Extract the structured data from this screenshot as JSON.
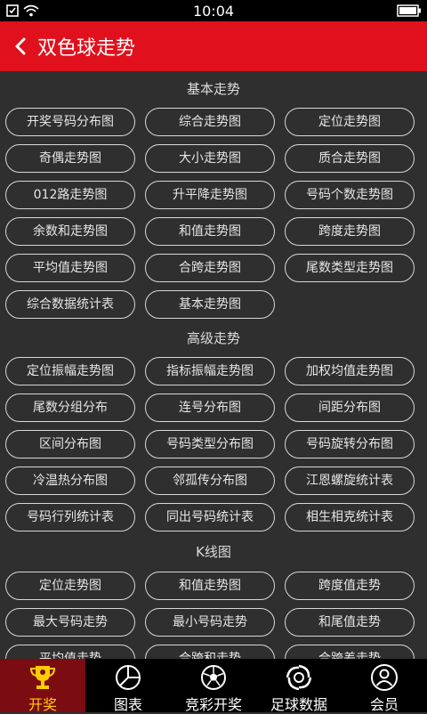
{
  "status": {
    "time": "10:04"
  },
  "header": {
    "title": "双色球走势"
  },
  "sections": [
    {
      "title": "基本走势",
      "items": [
        "开奖号码分布图",
        "综合走势图",
        "定位走势图",
        "奇偶走势图",
        "大小走势图",
        "质合走势图",
        "012路走势图",
        "升平降走势图",
        "号码个数走势图",
        "余数和走势图",
        "和值走势图",
        "跨度走势图",
        "平均值走势图",
        "合跨走势图",
        "尾数类型走势图",
        "综合数据统计表",
        "基本走势图"
      ]
    },
    {
      "title": "高级走势",
      "items": [
        "定位振幅走势图",
        "指标振幅走势图",
        "加权均值走势图",
        "尾数分组分布",
        "连号分布图",
        "间距分布图",
        "区间分布图",
        "号码类型分布图",
        "号码旋转分布图",
        "冷温热分布图",
        "邻孤传分布图",
        "江恩螺旋统计表",
        "号码行列统计表",
        "同出号码统计表",
        "相生相克统计表"
      ]
    },
    {
      "title": "K线图",
      "items": [
        "定位走势图",
        "和值走势图",
        "跨度值走势",
        "最大号码走势",
        "最小号码走势",
        "和尾值走势",
        "平均值走势",
        "合跨和走势",
        "合跨差走势"
      ]
    }
  ],
  "tabs": [
    {
      "label": "开奖",
      "icon": "trophy-icon",
      "active": true
    },
    {
      "label": "图表",
      "icon": "pie-chart-icon",
      "active": false
    },
    {
      "label": "竞彩开奖",
      "icon": "soccer-ball-icon",
      "active": false
    },
    {
      "label": "足球数据",
      "icon": "swirl-icon",
      "active": false
    },
    {
      "label": "会员",
      "icon": "user-icon",
      "active": false
    }
  ],
  "colors": {
    "accent": "#e0111c",
    "background": "#2f2f2f",
    "active_tab_bg": "#7a0c12",
    "active_tab_fg": "#ffcc00"
  }
}
